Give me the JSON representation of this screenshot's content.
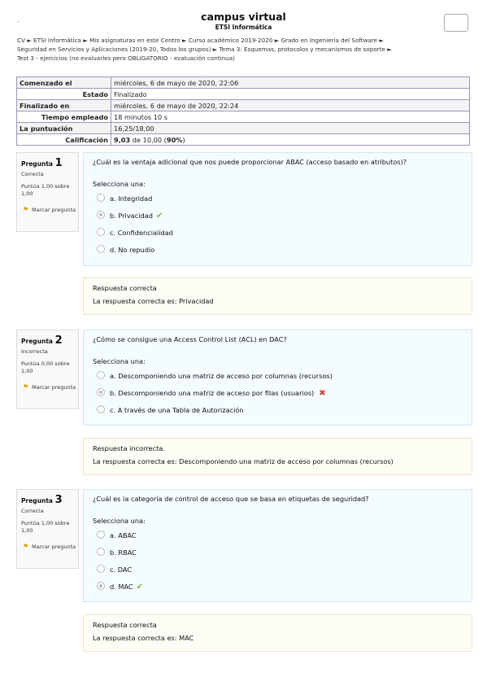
{
  "header": {
    "dot": ".",
    "site_title": "campus virtual",
    "site_subtitle": "ETSI Informática"
  },
  "breadcrumb": [
    "CV ►",
    "ETSI Informática ►",
    "Mis asignaturas en este Centro ►",
    "Curso académico 2019-2020 ►",
    "Grado en Ingeniería del Software ►",
    "Seguridad en Servicios y Aplicaciones (2019-20, Todos los grupos) ►",
    "Tema 3: Esquemas, protocolos y mecanismos de soporte ►",
    "Test 3 - ejercicios (no evaluarles pero OBLIGATORIO - evaluación continua)"
  ],
  "summary": {
    "started_label": "Comenzado el",
    "started_value": "miércoles, 6 de mayo de 2020, 22:06",
    "state_label": "Estado",
    "state_value": "Finalizado",
    "finished_label": "Finalizado en",
    "finished_value": "miércoles, 6 de mayo de 2020, 22:24",
    "time_label": "Tiempo empleado",
    "time_value": "18 minutos 10 s",
    "points_label": "La puntuación",
    "points_value": "16,25/18,00",
    "grade_label": "Calificación",
    "grade_value_bold": "9,03",
    "grade_value_mid": " de 10,00 (",
    "grade_percent": "90%",
    "grade_value_end": ")"
  },
  "questions": [
    {
      "label": "Pregunta",
      "number": "1",
      "state": "Correcta",
      "points": "Puntúa 1,00 sobre 1,00",
      "flag": "Marcar pregunta",
      "text": "¿Cuál es la ventaja adicional que nos puede proporcionar ABAC (acceso basado en atributos)?",
      "prompt": "Selecciona una:",
      "options": [
        "a. Integridad",
        "b. Privacidad",
        "c. Confidencialidad",
        "d. No repudio"
      ],
      "feedback_status": "Respuesta correcta",
      "feedback_answer": "La respuesta correcta es: Privacidad"
    },
    {
      "label": "Pregunta",
      "number": "2",
      "state": "Incorrecta",
      "points": "Puntúa 0,00 sobre 1,00",
      "flag": "Marcar pregunta",
      "text": "¿Cómo se consigue una Access Control List (ACL) en DAC?",
      "prompt": "Selecciona una:",
      "options": [
        "a. Descomponiendo una matriz de acceso por columnas (recursos)",
        "b. Descomponiendo una matriz de acceso por filas (usuarios)",
        "c. A través de una Tabla de Autorización"
      ],
      "feedback_status": "Respuesta incorrecta.",
      "feedback_answer": "La respuesta correcta es: Descomponiendo una matriz de acceso por columnas (recursos)"
    },
    {
      "label": "Pregunta",
      "number": "3",
      "state": "Correcta",
      "points": "Puntúa 1,00 sobre 1,00",
      "flag": "Marcar pregunta",
      "text": "¿Cuál es la categoría de control de acceso que se basa en etiquetas de seguridad?",
      "prompt": "Selecciona una:",
      "options": [
        "a. ABAC",
        "b. RBAC",
        "c. DAC",
        "d. MAC"
      ],
      "feedback_status": "Respuesta correcta",
      "feedback_answer": "La respuesta correcta es: MAC"
    }
  ],
  "marks": {
    "correct": "✔",
    "incorrect": "✖"
  },
  "icons": {
    "flag": "flag-icon",
    "check": "check-icon",
    "cross": "cross-icon",
    "radio": "radio-icon"
  },
  "colors": {
    "correct": "#7cb342",
    "incorrect": "#e53935",
    "flag": "#d8a400",
    "question_bg": "#f5fcfe",
    "feedback_bg": "#fdfcf5"
  }
}
